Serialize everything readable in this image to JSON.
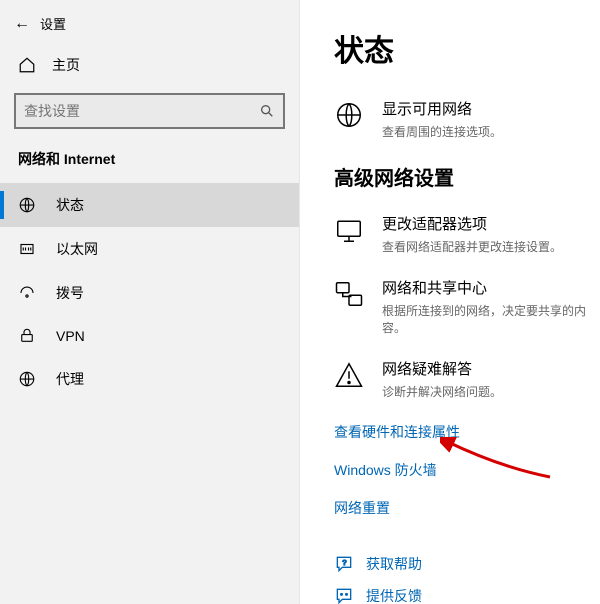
{
  "titlebar": {
    "app_title": "设置"
  },
  "home": {
    "label": "主页"
  },
  "search": {
    "placeholder": "查找设置"
  },
  "section_title": "网络和 Internet",
  "nav": {
    "status": "状态",
    "ethernet": "以太网",
    "dialup": "拨号",
    "vpn": "VPN",
    "proxy": "代理"
  },
  "main": {
    "page_title": "状态",
    "show_networks": {
      "title": "显示可用网络",
      "sub": "查看周围的连接选项。"
    },
    "advanced_heading": "高级网络设置",
    "adapter": {
      "title": "更改适配器选项",
      "sub": "查看网络适配器并更改连接设置。"
    },
    "sharing": {
      "title": "网络和共享中心",
      "sub": "根据所连接到的网络，决定要共享的内容。"
    },
    "troubleshoot": {
      "title": "网络疑难解答",
      "sub": "诊断并解决网络问题。"
    },
    "link_hardware": "查看硬件和连接属性",
    "link_firewall": "Windows 防火墙",
    "link_reset": "网络重置",
    "help": "获取帮助",
    "feedback": "提供反馈"
  }
}
